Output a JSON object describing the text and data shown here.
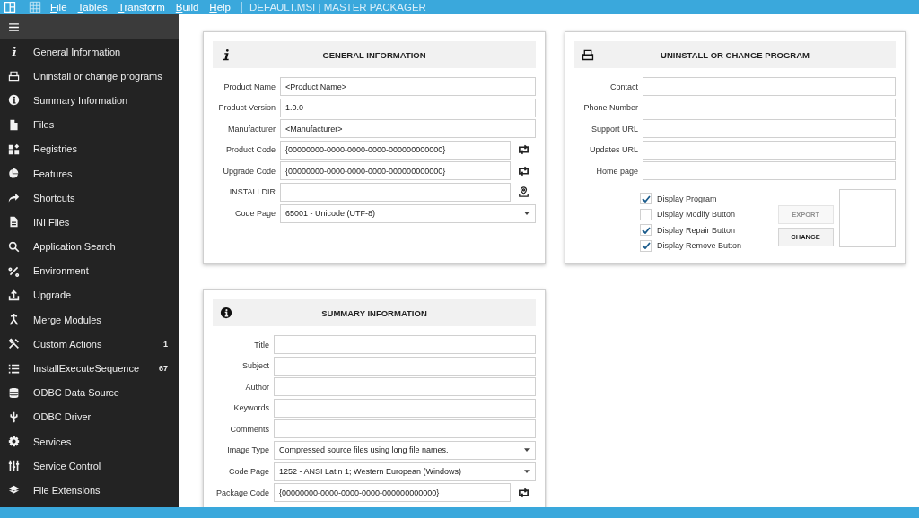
{
  "menu_bar": {
    "items": [
      "File",
      "Tables",
      "Transform",
      "Build",
      "Help"
    ],
    "title": "DEFAULT.MSI | MASTER PACKAGER"
  },
  "sidebar": {
    "items": [
      {
        "label": "General Information"
      },
      {
        "label": "Uninstall or change programs"
      },
      {
        "label": "Summary Information"
      },
      {
        "label": "Files"
      },
      {
        "label": "Registries"
      },
      {
        "label": "Features"
      },
      {
        "label": "Shortcuts"
      },
      {
        "label": "INI Files"
      },
      {
        "label": "Application Search"
      },
      {
        "label": "Environment"
      },
      {
        "label": "Upgrade"
      },
      {
        "label": "Merge Modules"
      },
      {
        "label": "Custom Actions",
        "count": "1"
      },
      {
        "label": "InstallExecuteSequence",
        "count": "67"
      },
      {
        "label": "ODBC Data Source"
      },
      {
        "label": "ODBC Driver"
      },
      {
        "label": "Services"
      },
      {
        "label": "Service Control"
      },
      {
        "label": "File Extensions"
      }
    ]
  },
  "cards": [
    {
      "title": "GENERAL INFORMATION",
      "fields": [
        {
          "label": "Product Name",
          "kind": "text",
          "value": "<Product Name>"
        },
        {
          "label": "Product Version",
          "kind": "text",
          "value": "1.0.0"
        },
        {
          "label": "Manufacturer",
          "kind": "text",
          "value": "<Manufacturer>"
        },
        {
          "label": "Product Code",
          "kind": "code",
          "value": "{00000000-0000-0000-0000-000000000000}"
        },
        {
          "label": "Upgrade Code",
          "kind": "code",
          "value": "{00000000-0000-0000-0000-000000000000}"
        },
        {
          "label": "INSTALLDIR",
          "kind": "folder"
        },
        {
          "label": "Code Page",
          "kind": "dropdown",
          "value": "65001 - Unicode (UTF-8)"
        }
      ]
    },
    {
      "title": "UNINSTALL OR CHANGE PROGRAM",
      "fields": [
        {
          "label": "Contact",
          "kind": "text"
        },
        {
          "label": "Phone Number",
          "kind": "text"
        },
        {
          "label": "Support URL",
          "kind": "text"
        },
        {
          "label": "Updates URL",
          "kind": "text"
        },
        {
          "label": "Home page",
          "kind": "text"
        }
      ],
      "checkboxes": [
        {
          "label": "Display Program",
          "checked": true
        },
        {
          "label": "Display Modify Button",
          "checked": false
        },
        {
          "label": "Display Repair Button",
          "checked": true
        },
        {
          "label": "Display Remove Button",
          "checked": true
        }
      ],
      "buttons": [
        {
          "label": "EXPORT",
          "disabled": true
        },
        {
          "label": "CHANGE",
          "disabled": false
        }
      ]
    },
    {
      "title": "SUMMARY INFORMATION",
      "fields": [
        {
          "label": "Title",
          "kind": "text"
        },
        {
          "label": "Subject",
          "kind": "text"
        },
        {
          "label": "Author",
          "kind": "text"
        },
        {
          "label": "Keywords",
          "kind": "text"
        },
        {
          "label": "Comments",
          "kind": "text"
        },
        {
          "label": "Image Type",
          "kind": "dropdown",
          "value": "Compressed source files using long file names."
        },
        {
          "label": "Code Page",
          "kind": "dropdown",
          "value": "1252 - ANSI Latin 1; Western European (Windows)"
        },
        {
          "label": "Package Code",
          "kind": "code",
          "value": "{00000000-0000-0000-0000-000000000000}"
        }
      ]
    }
  ]
}
